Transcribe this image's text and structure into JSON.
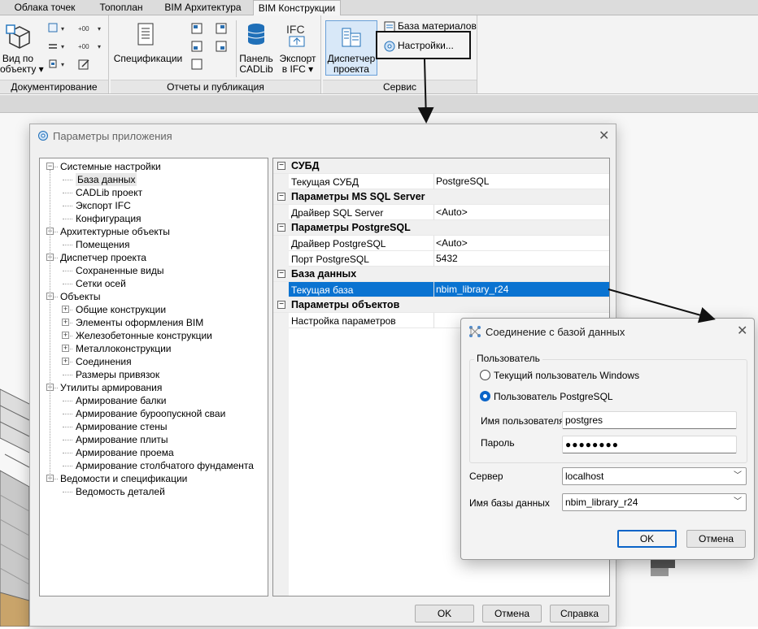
{
  "ribbon": {
    "tabs": [
      "Облака точек",
      "Топоплан",
      "BIM Архитектура",
      "BIM Конструкции"
    ],
    "active_tab": "BIM Конструкции",
    "panels": {
      "doc": {
        "title": "Документирование",
        "view_by_object": "Вид по\nобъекту ▾"
      },
      "reports": {
        "title": "Отчеты и публикация",
        "specs": "Спецификации",
        "cadlib_panel": "Панель\nCADLib",
        "ifc_export": "Экспорт\nв IFC ▾"
      },
      "service": {
        "title": "Сервис",
        "project_manager": "Диспетчер\nпроекта",
        "materials_db": "База материалов",
        "settings": "Настройки..."
      }
    }
  },
  "app_dialog": {
    "title": "Параметры приложения",
    "tree": [
      {
        "label": "Системные настройки",
        "level": 0,
        "expanded": true
      },
      {
        "label": "База данных",
        "level": 1
      },
      {
        "label": "CADLib проект",
        "level": 1
      },
      {
        "label": "Экспорт IFC",
        "level": 1
      },
      {
        "label": "Конфигурация",
        "level": 1
      },
      {
        "label": "Архитектурные объекты",
        "level": 0,
        "expanded": true
      },
      {
        "label": "Помещения",
        "level": 1
      },
      {
        "label": "Диспетчер проекта",
        "level": 0,
        "expanded": true
      },
      {
        "label": "Сохраненные виды",
        "level": 1
      },
      {
        "label": "Сетки осей",
        "level": 1
      },
      {
        "label": "Объекты",
        "level": 0,
        "expanded": true
      },
      {
        "label": "Общие конструкции",
        "level": 1,
        "box": "+"
      },
      {
        "label": "Элементы оформления BIM",
        "level": 1,
        "box": "+"
      },
      {
        "label": "Железобетонные конструкции",
        "level": 1,
        "box": "+"
      },
      {
        "label": "Металлоконструкции",
        "level": 1,
        "box": "+"
      },
      {
        "label": "Соединения",
        "level": 1,
        "box": "+"
      },
      {
        "label": "Размеры привязок",
        "level": 1
      },
      {
        "label": "Утилиты армирования",
        "level": 0,
        "expanded": true
      },
      {
        "label": "Армирование балки",
        "level": 1
      },
      {
        "label": "Армирование буроопускной сваи",
        "level": 1
      },
      {
        "label": "Армирование стены",
        "level": 1
      },
      {
        "label": "Армирование плиты",
        "level": 1
      },
      {
        "label": "Армирование проема",
        "level": 1
      },
      {
        "label": "Армирование столбчатого фундамента",
        "level": 1
      },
      {
        "label": "Ведомости и спецификации",
        "level": 0,
        "expanded": true
      },
      {
        "label": "Ведомость деталей",
        "level": 1
      }
    ],
    "grid": [
      {
        "type": "cat",
        "name": "СУБД"
      },
      {
        "type": "prop",
        "name": "Текущая СУБД",
        "value": "PostgreSQL"
      },
      {
        "type": "cat",
        "name": "Параметры MS SQL Server"
      },
      {
        "type": "prop",
        "name": "Драйвер SQL Server",
        "value": "<Auto>"
      },
      {
        "type": "cat",
        "name": "Параметры PostgreSQL"
      },
      {
        "type": "prop",
        "name": "Драйвер PostgreSQL",
        "value": "<Auto>"
      },
      {
        "type": "prop",
        "name": "Порт PostgreSQL",
        "value": "5432"
      },
      {
        "type": "cat",
        "name": "База данных"
      },
      {
        "type": "prop",
        "name": "Текущая база",
        "value": "nbim_library_r24",
        "selected": true
      },
      {
        "type": "cat",
        "name": "Параметры объектов"
      },
      {
        "type": "prop",
        "name": "Настройка параметров",
        "value": ""
      }
    ],
    "buttons": {
      "ok": "OK",
      "cancel": "Отмена",
      "help": "Справка"
    }
  },
  "db_dialog": {
    "title": "Соединение с базой данных",
    "group_label": "Пользователь",
    "radio_windows": "Текущий пользователь Windows",
    "radio_postgres": "Пользователь PostgreSQL",
    "username_label": "Имя пользователя",
    "username_value": "postgres",
    "password_label": "Пароль",
    "password_value": "●●●●●●●●",
    "server_label": "Сервер",
    "server_value": "localhost",
    "dbname_label": "Имя базы данных",
    "dbname_value": "nbim_library_r24",
    "ok": "OK",
    "cancel": "Отмена"
  },
  "colors": {
    "selection": "#0a73d1",
    "default_button_border": "#0a64c8"
  }
}
